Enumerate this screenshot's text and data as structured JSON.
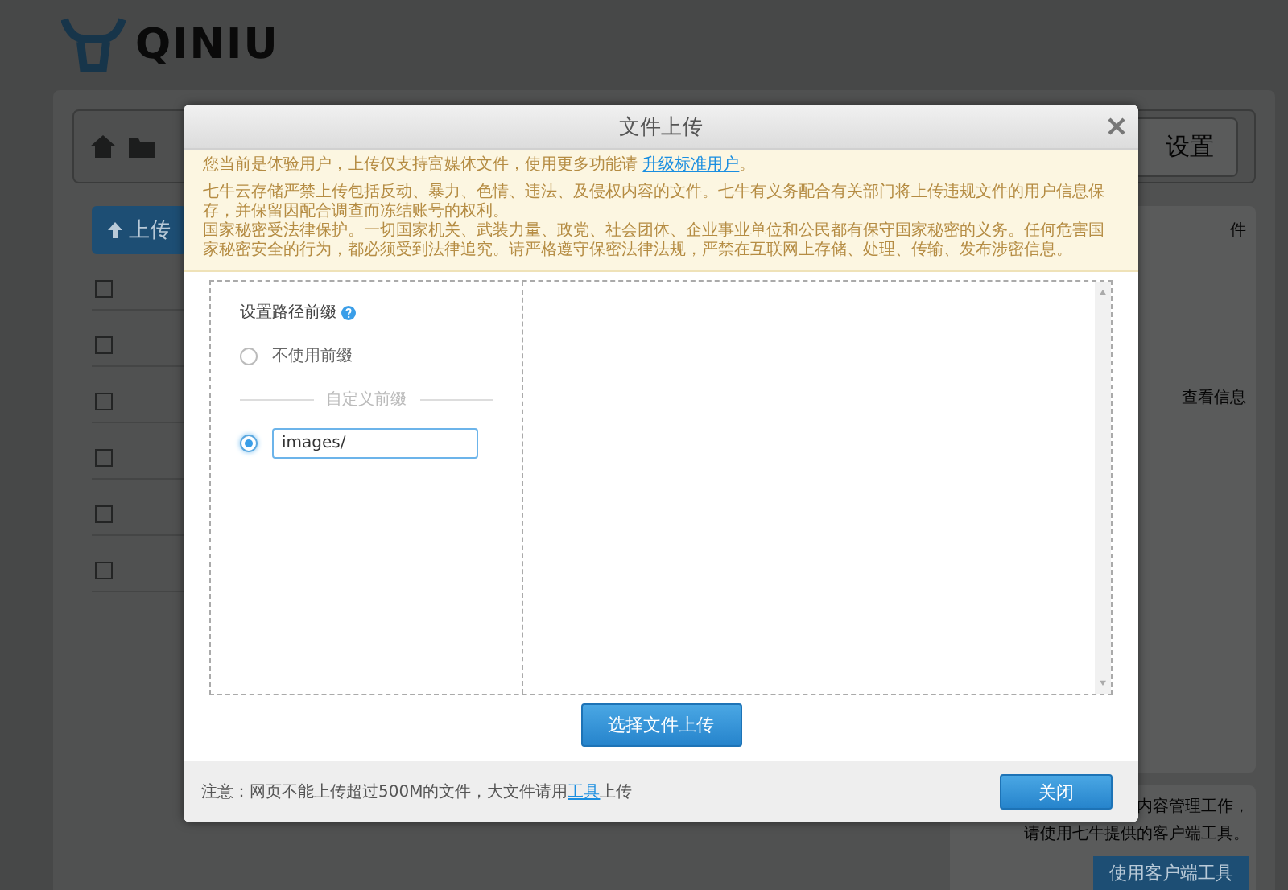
{
  "background": {
    "logo": "QINIU",
    "settings_button": "设置",
    "upload_button": "上传",
    "rows": [
      {
        "checked": false
      },
      {
        "checked": false
      },
      {
        "checked": false
      },
      {
        "checked": false
      },
      {
        "checked": false
      },
      {
        "checked": false
      }
    ],
    "side_panel": {
      "heading": "件",
      "link": "查看信息"
    },
    "help_panel": {
      "lines": [
        "内容管理工作，",
        "请使用七牛提供的客户端工具。"
      ],
      "button": "使用客户端工具"
    }
  },
  "dialog": {
    "title": "文件上传",
    "notice": {
      "intro": "您当前是体验用户，上传仅支持富媒体文件，使用更多功能请 ",
      "link": "升级标准用户",
      "intro_end": "。",
      "paragraphs": [
        "七牛云存储严禁上传包括反动、暴力、色情、违法、及侵权内容的文件。七牛有义务配合有关部门将上传违规文件的用户信息保存，并保留因配合调查而冻结账号的权利。",
        "国家秘密受法律保护。一切国家机关、武装力量、政党、社会团体、企业事业单位和公民都有保守国家秘密的义务。任何危害国家秘密安全的行为，都必须受到法律追究。请严格遵守保密法律法规，严禁在互联网上存储、处理、传输、发布涉密信息。"
      ]
    },
    "prefix": {
      "label": "设置路径前缀",
      "divider": "自定义前缀",
      "options": [
        {
          "kind": "plain",
          "label": "不使用前缀",
          "selected": false
        },
        {
          "kind": "input",
          "value": "images/",
          "selected": true
        }
      ]
    },
    "choose_button": "选择文件上传",
    "footer": {
      "note": "注意：网页不能上传超过500M的文件，大文件请用",
      "link": "工具",
      "note_end": "上传",
      "close_button": "关闭"
    }
  }
}
